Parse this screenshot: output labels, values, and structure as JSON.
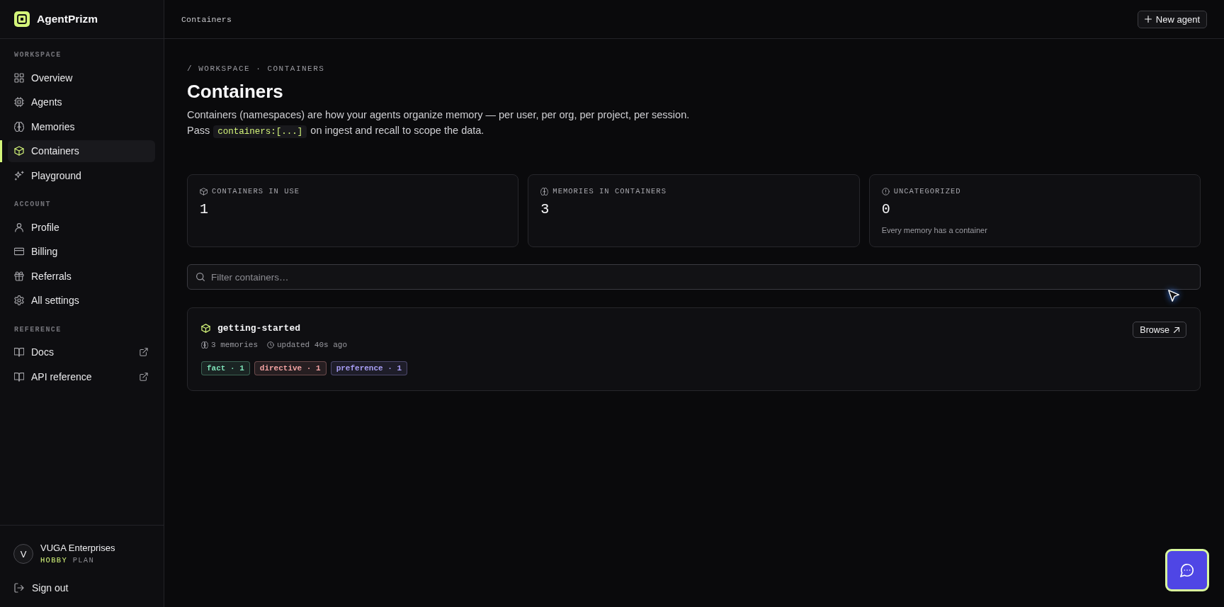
{
  "app": {
    "name": "AgentPrizm"
  },
  "sidebar": {
    "sections": [
      {
        "label": "WORKSPACE",
        "items": [
          {
            "label": "Overview",
            "selected": false,
            "external": false
          },
          {
            "label": "Agents",
            "selected": false,
            "external": false
          },
          {
            "label": "Memories",
            "selected": false,
            "external": false
          },
          {
            "label": "Containers",
            "selected": true,
            "external": false
          },
          {
            "label": "Playground",
            "selected": false,
            "external": false
          }
        ]
      },
      {
        "label": "ACCOUNT",
        "items": [
          {
            "label": "Profile",
            "selected": false,
            "external": false
          },
          {
            "label": "Billing",
            "selected": false,
            "external": false
          },
          {
            "label": "Referrals",
            "selected": false,
            "external": false
          },
          {
            "label": "All settings",
            "selected": false,
            "external": false
          }
        ]
      },
      {
        "label": "REFERENCE",
        "items": [
          {
            "label": "Docs",
            "selected": false,
            "external": true
          },
          {
            "label": "API reference",
            "selected": false,
            "external": true
          }
        ]
      }
    ],
    "account": {
      "initial": "V",
      "name": "VUGA Enterprises",
      "plan": "HOBBY",
      "plan_suffix": "PLAN"
    },
    "sign_out": "Sign out"
  },
  "topbar": {
    "title": "Containers",
    "new_agent": "New agent"
  },
  "page": {
    "breadcrumb": "/ WORKSPACE · CONTAINERS",
    "title": "Containers",
    "description": "Containers (namespaces) are how your agents organize memory — per user, per org, per project, per session.",
    "usage": {
      "before": "Pass",
      "code": "containers:[...]",
      "after": "on ingest and recall to scope the data."
    }
  },
  "stats": [
    {
      "label": "CONTAINERS IN USE",
      "value": "1"
    },
    {
      "label": "MEMORIES IN CONTAINERS",
      "value": "3"
    },
    {
      "label": "UNCATEGORIZED",
      "value": "0",
      "caption": "Every memory has a container"
    }
  ],
  "filter": {
    "placeholder": "Filter containers…"
  },
  "containers": [
    {
      "name": "getting-started",
      "memories": "3 memories",
      "updated": "updated 40s ago",
      "tags": [
        {
          "label": "fact · 1",
          "color": "#7ee2b8"
        },
        {
          "label": "directive · 1",
          "color": "#f4a3a3"
        },
        {
          "label": "preference · 1",
          "color": "#a99ff7"
        }
      ],
      "action": "Browse"
    }
  ]
}
